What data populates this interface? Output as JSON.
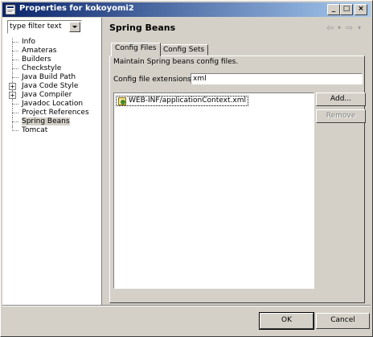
{
  "window": {
    "title": "Properties for kokoyomi2",
    "minimize": "_",
    "maximize": "□",
    "close": "×"
  },
  "sidebar": {
    "filter_text": "type filter text",
    "items": [
      {
        "label": "Info",
        "expandable": false
      },
      {
        "label": "Amateras",
        "expandable": false
      },
      {
        "label": "Builders",
        "expandable": false
      },
      {
        "label": "Checkstyle",
        "expandable": false
      },
      {
        "label": "Java Build Path",
        "expandable": false
      },
      {
        "label": "Java Code Style",
        "expandable": true
      },
      {
        "label": "Java Compiler",
        "expandable": true
      },
      {
        "label": "Javadoc Location",
        "expandable": false
      },
      {
        "label": "Project References",
        "expandable": false
      },
      {
        "label": "Spring Beans",
        "expandable": false,
        "selected": true
      },
      {
        "label": "Tomcat",
        "expandable": false
      }
    ]
  },
  "main": {
    "title": "Spring Beans",
    "nav_back": "⇦",
    "nav_forward": "⇨",
    "nav_dropdown": "▾",
    "tabs": [
      "Config Files",
      "Config Sets"
    ],
    "description": "Maintain Spring beans config files.",
    "ext_label": "Config file extensions",
    "ext_value": "xml",
    "files": [
      "WEB-INF/applicationContext.xml"
    ],
    "add_label": "Add...",
    "remove_label": "Remove"
  },
  "footer": {
    "ok_label": "OK",
    "cancel_label": "Cancel"
  }
}
